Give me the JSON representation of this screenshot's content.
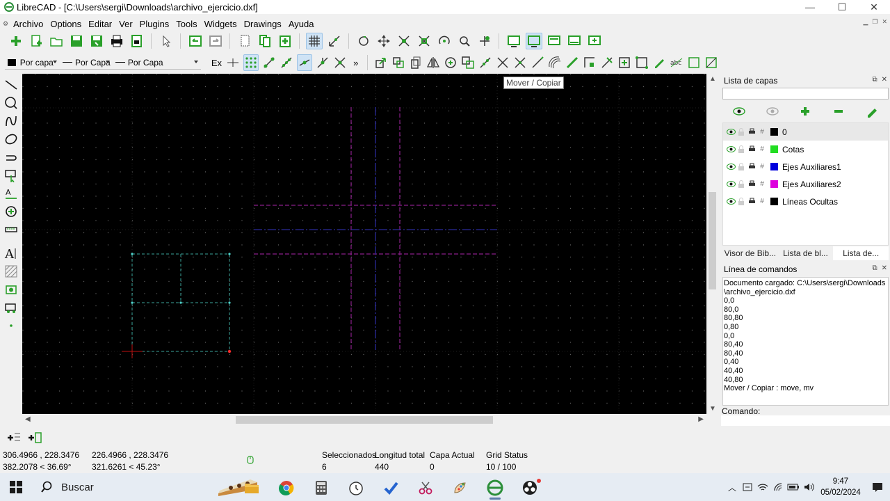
{
  "window": {
    "title": "LibreCAD - [C:\\Users\\sergi\\Downloads\\archivo_ejercicio.dxf]",
    "minimize": "—",
    "maximize": "☐",
    "close": "✕"
  },
  "menu": {
    "items": [
      "Archivo",
      "Options",
      "Editar",
      "Ver",
      "Plugins",
      "Tools",
      "Widgets",
      "Drawings",
      "Ayuda"
    ]
  },
  "pen": {
    "color_label": "Por capa",
    "linetype_label": "Por Capa",
    "linewidth_label": "Por Capa"
  },
  "snap": {
    "exclusive_label": "Ex",
    "more_label": "»"
  },
  "tooltip": {
    "text": "Mover / Copiar"
  },
  "layers_dock": {
    "title": "Lista de capas",
    "layers": [
      {
        "name": "0",
        "color": "#000000"
      },
      {
        "name": "Cotas",
        "color": "#22dd22"
      },
      {
        "name": "Ejes Auxiliares1",
        "color": "#0000dd"
      },
      {
        "name": "Ejes Auxiliares2",
        "color": "#dd00dd"
      },
      {
        "name": "Líneas Ocultas",
        "color": "#000000"
      }
    ],
    "tabs": [
      "Visor de Bib...",
      "Lista de bl...",
      "Lista de..."
    ]
  },
  "command_dock": {
    "title": "Línea de comandos",
    "output_lines": [
      "Documento cargado: C:\\Users\\sergi\\Downloads",
      "\\archivo_ejercicio.dxf",
      "0,0",
      "80,0",
      "80,80",
      "0,80",
      "0,0",
      "80,40",
      "80,40",
      "0,40",
      "40,40",
      "40,80",
      "Mover / Copiar : move, mv"
    ],
    "prompt_label": "Comando:"
  },
  "status": {
    "abs_coord": "306.4966 , 228.3476",
    "abs_polar": "382.2078 < 36.69°",
    "rel_coord": "226.4966 , 228.3476",
    "rel_polar": "321.6261 < 45.23°",
    "selected_label": "Seleccionados",
    "selected_value": "6",
    "length_label": "Longitud total",
    "length_value": "440",
    "layer_label": "Capa Actual",
    "layer_value": "0",
    "grid_label": "Grid Status",
    "grid_value": "10 / 100"
  },
  "taskbar": {
    "search_label": "Buscar",
    "time": "9:47",
    "date": "05/02/2024"
  },
  "colors": {
    "canvas_bg": "#000000",
    "grid_dot": "#5a5a5a",
    "dashed_cyan": "#3aa39a",
    "dashed_magenta": "#8a1f8a",
    "dashed_blue": "#2a2a9a"
  }
}
